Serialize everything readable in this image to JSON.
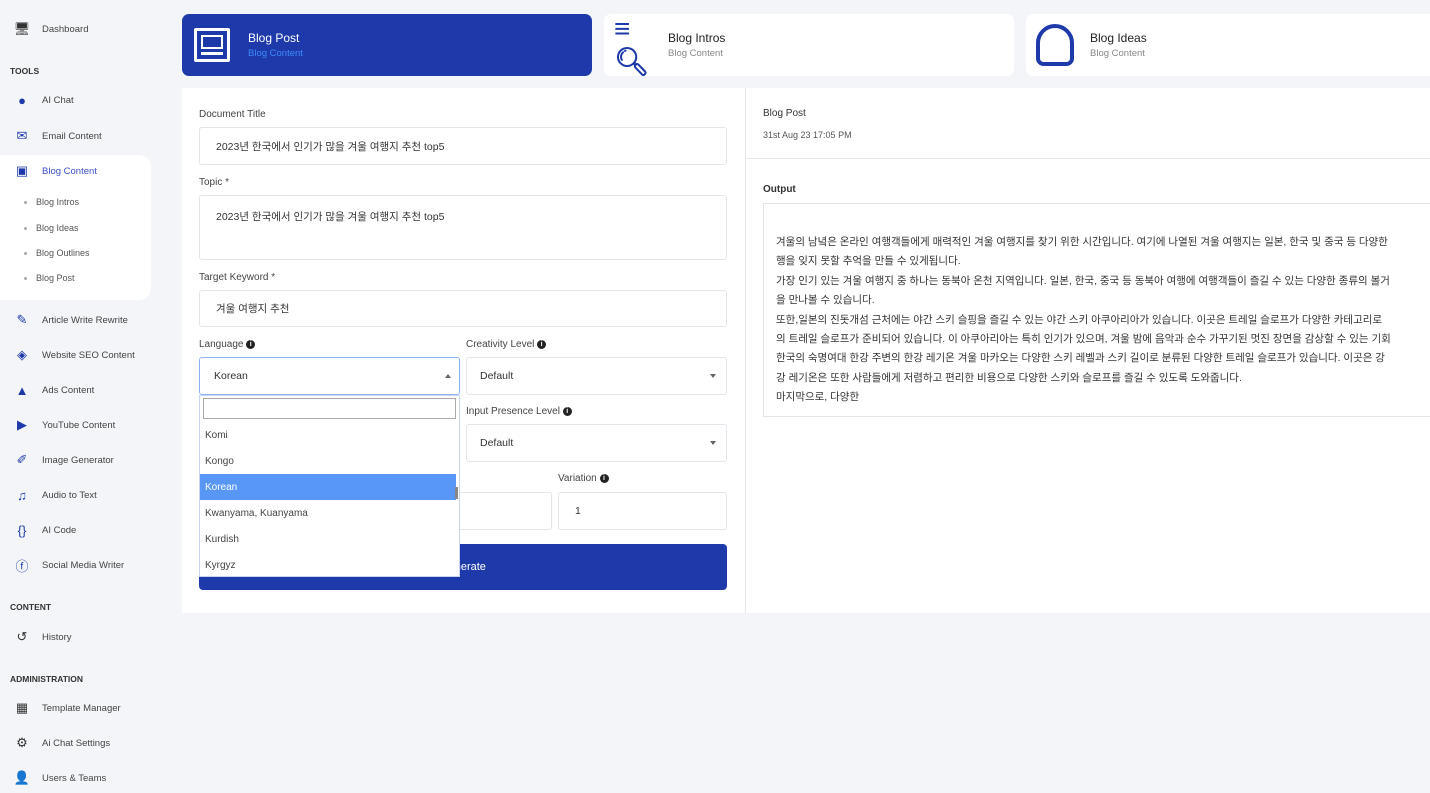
{
  "sidebar": {
    "dashboard": "Dashboard",
    "tools_heading": "TOOLS",
    "ai_chat": "AI Chat",
    "email_content": "Email Content",
    "blog_content": "Blog Content",
    "blog_sub": [
      "Blog Intros",
      "Blog Ideas",
      "Blog Outlines",
      "Blog Post"
    ],
    "article": "Article Write Rewrite",
    "seo": "Website SEO Content",
    "ads": "Ads Content",
    "youtube": "YouTube Content",
    "image": "Image Generator",
    "audio": "Audio to Text",
    "code": "AI Code",
    "social": "Social Media Writer",
    "content_heading": "CONTENT",
    "history": "History",
    "admin_heading": "ADMINISTRATION",
    "template": "Template Manager",
    "chat_settings": "Ai Chat Settings",
    "users": "Users & Teams"
  },
  "cards": [
    {
      "title": "Blog Post",
      "subtitle": "Blog Content"
    },
    {
      "title": "Blog Intros",
      "subtitle": "Blog Content"
    },
    {
      "title": "Blog Ideas",
      "subtitle": "Blog Content"
    }
  ],
  "form": {
    "doc_title_label": "Document Title",
    "doc_title_value": "2023년 한국에서 인기가 많을 겨울 여행지 추천 top5",
    "topic_label": "Topic *",
    "topic_value": "2023년 한국에서 인기가 많을 겨울 여행지 추천 top5",
    "keyword_label": "Target Keyword *",
    "keyword_value": "겨울 여행지 추천",
    "language_label": "Language",
    "language_value": "Korean",
    "language_options": [
      "Komi",
      "Kongo",
      "Korean",
      "Kwanyama, Kuanyama",
      "Kurdish",
      "Kyrgyz"
    ],
    "creativity_label": "Creativity Level",
    "creativity_value": "Default",
    "presence_label": "Input Presence Level",
    "presence_value": "Default",
    "variation_label": "Variation",
    "variation_value": "1",
    "generate": "Generate"
  },
  "output": {
    "title": "Blog Post",
    "date": "31st Aug 23 17:05 PM",
    "label": "Output",
    "lines": [
      "겨울의 남녘은 온라인 여행객들에게 매력적인 겨울 여행지를 찾기 위한 시간입니다. 여기에 나열된 겨울 여행지는 일본, 한국 및 중국 등 다양한",
      "행을 잊지 못할 추억을 만들 수 있게됩니다.",
      "가장 인기 있는 겨울 여행지 중 하나는 동북아 온천 지역입니다. 일본, 한국, 중국 등 동북아 여행에 여행객들이 즐길 수 있는 다양한 종류의 볼거",
      "을 만나볼 수 있습니다.",
      "또한,일본의 진돗개섬 근처에는 야간 스키 슬핑을 즐길 수 있는 야간 스키 아쿠아리아가 있습니다. 이곳은 트레일 슬로프가 다양한 카테고리로",
      "의 트레일 슬로프가 준비되어 있습니다. 이 아쿠아리아는 특히 인기가 있으며, 겨울 밤에 음악과 순수 가꾸기된 멋진 장면을 감상할 수 있는 기회",
      "한국의 숙명여대 한강 주변의 한강 레기온 겨울 마카오는 다양한 스키 레벨과 스키 길이로 분류된 다양한 트레일 슬로프가 있습니다. 이곳은 강",
      "강 레기온은 또한 사람들에게 저렴하고 편리한 비용으로 다양한 스키와 슬로프를 즐길 수 있도록 도와줍니다.",
      "마지막으로, 다양한"
    ]
  },
  "colors": {
    "primary": "#1e3aaa",
    "selected_option": "#5897f6",
    "accent_text": "#3d8bfd"
  }
}
